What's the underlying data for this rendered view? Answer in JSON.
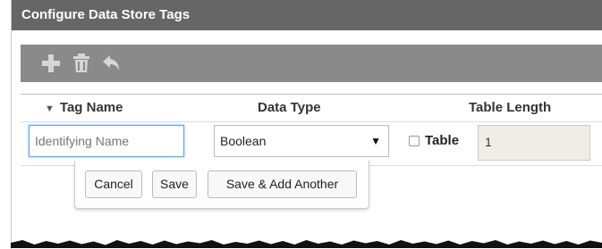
{
  "dialog": {
    "title": "Configure Data Store Tags"
  },
  "toolbar": {
    "buttons": [
      {
        "icon": "plus-icon"
      },
      {
        "icon": "trash-icon"
      },
      {
        "icon": "undo-icon"
      }
    ],
    "color": "#8a8a8a"
  },
  "grid": {
    "columns": {
      "tag_name": "Tag Name",
      "data_type": "Data Type",
      "table_length": "Table Length"
    },
    "sort_indicator": "▼",
    "row": {
      "name_placeholder": "Identifying Name",
      "name_value": "",
      "data_type_value": "Boolean",
      "table_checkbox_label": "Table",
      "table_checked": false,
      "table_length_value": "1"
    }
  },
  "actions": {
    "cancel": "Cancel",
    "save": "Save",
    "save_add": "Save & Add Another"
  },
  "colors": {
    "titlebar": "#666666",
    "focus_border": "#66a3e0",
    "disabled_input": "#eeeee6"
  }
}
